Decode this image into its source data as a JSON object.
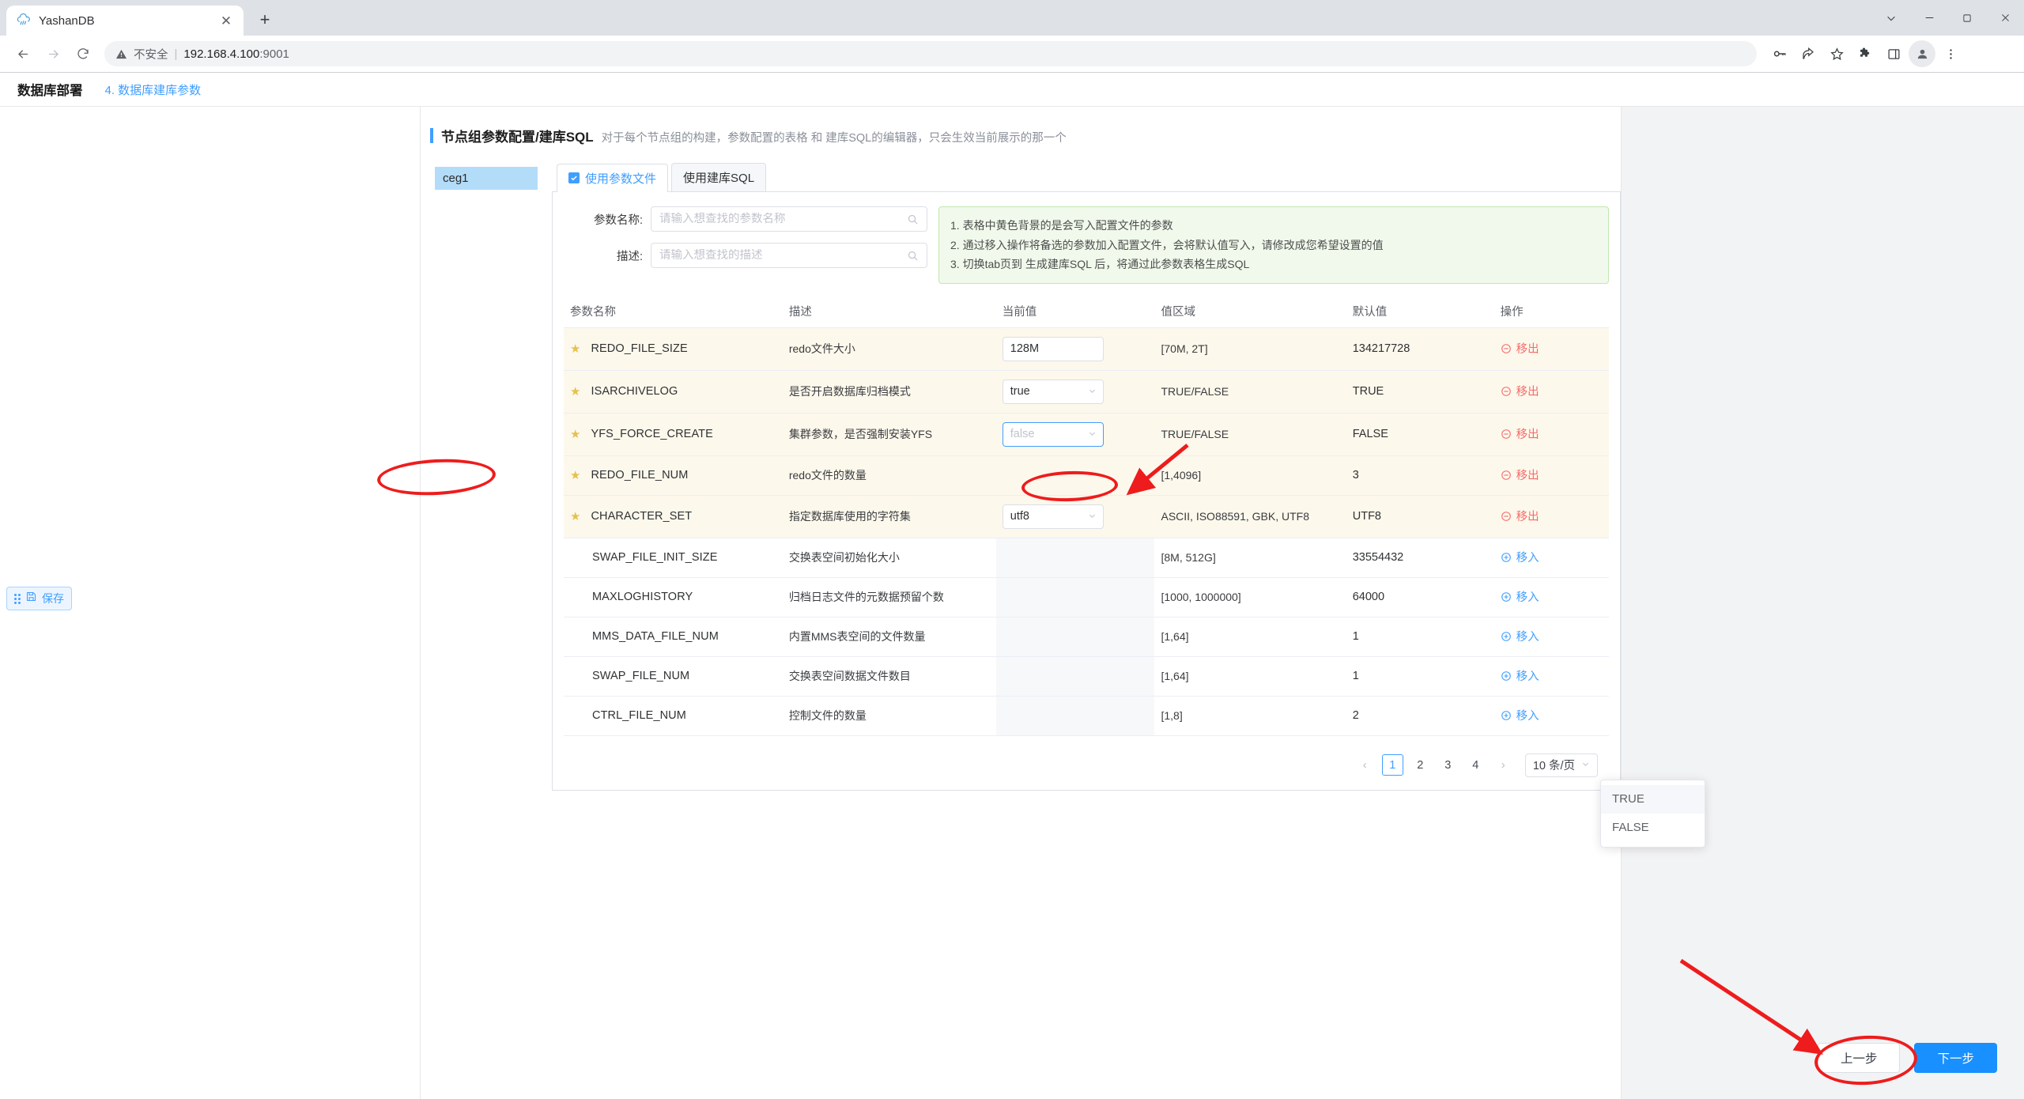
{
  "browser": {
    "tab": {
      "title": "YashanDB",
      "favicon_icon": "yashandb-logo-icon",
      "close_icon": "close-icon"
    },
    "new_tab_icon": "plus-icon",
    "window_controls": [
      {
        "name": "minimize-to-tray",
        "icon": "chevron-down-icon"
      },
      {
        "name": "minimize",
        "icon": "minimize-icon"
      },
      {
        "name": "maximize",
        "icon": "maximize-icon"
      },
      {
        "name": "close",
        "icon": "close-icon"
      }
    ],
    "nav": {
      "back_icon": "back-arrow-icon",
      "forward_icon": "forward-arrow-icon",
      "reload_icon": "reload-icon"
    },
    "omnibox": {
      "warning_icon": "warning-triangle-icon",
      "security_text": "不安全",
      "separator": "|",
      "url_host": "192.168.4.100",
      "url_port": ":9001"
    },
    "toolbar_icons": [
      {
        "name": "password-key-icon"
      },
      {
        "name": "share-icon"
      },
      {
        "name": "bookmark-star-icon"
      },
      {
        "name": "extensions-puzzle-icon"
      },
      {
        "name": "side-panel-icon"
      },
      {
        "name": "profile-avatar-icon"
      },
      {
        "name": "more-menu-icon"
      }
    ]
  },
  "app": {
    "breadcrumb": {
      "title": "数据库部署",
      "step_link": "4. 数据库建库参数"
    },
    "page": {
      "title": "节点组参数配置/建库SQL",
      "description": "对于每个节点组的构建，参数配置的表格 和 建库SQL的编辑器，只会生效当前展示的那一个"
    },
    "node_groups": [
      {
        "label": "ceg1",
        "active": true
      }
    ],
    "tabs": [
      {
        "label": "使用参数文件",
        "active": true,
        "checked": true
      },
      {
        "label": "使用建库SQL",
        "active": false,
        "checked": false
      }
    ],
    "filters": [
      {
        "label": "参数名称:",
        "value": "",
        "placeholder": "请输入想查找的参数名称",
        "icon": "search-icon"
      },
      {
        "label": "描述:",
        "value": "",
        "placeholder": "请输入想查找的描述",
        "icon": "search-icon"
      }
    ],
    "notice": [
      "1. 表格中黄色背景的是会写入配置文件的参数",
      "2. 通过移入操作将备选的参数加入配置文件，会将默认值写入，请修改成您希望设置的值",
      "3. 切换tab页到 生成建库SQL 后，将通过此参数表格生成SQL"
    ],
    "table": {
      "columns": [
        "参数名称",
        "描述",
        "当前值",
        "值区域",
        "默认值",
        "操作"
      ],
      "rows": [
        {
          "starred": true,
          "in_config": true,
          "name": "REDO_FILE_SIZE",
          "desc": "redo文件大小",
          "current": {
            "type": "input",
            "value": "128M"
          },
          "range": "[70M, 2T]",
          "default": "134217728",
          "action": {
            "label": "移出",
            "type": "remove",
            "icon": "minus-circle-icon"
          }
        },
        {
          "starred": true,
          "in_config": true,
          "name": "ISARCHIVELOG",
          "desc": "是否开启数据库归档模式",
          "current": {
            "type": "select",
            "value": "true"
          },
          "range": "TRUE/FALSE",
          "default": "TRUE",
          "action": {
            "label": "移出",
            "type": "remove",
            "icon": "minus-circle-icon"
          }
        },
        {
          "starred": true,
          "in_config": true,
          "name": "YFS_FORCE_CREATE",
          "desc": "集群参数，是否强制安装YFS",
          "current": {
            "type": "select",
            "value": "false",
            "open": true
          },
          "range": "TRUE/FALSE",
          "default": "FALSE",
          "action": {
            "label": "移出",
            "type": "remove",
            "icon": "minus-circle-icon"
          }
        },
        {
          "starred": true,
          "in_config": true,
          "name": "REDO_FILE_NUM",
          "desc": "redo文件的数量",
          "current": {
            "type": "none",
            "value": ""
          },
          "range": "[1,4096]",
          "default": "3",
          "action": {
            "label": "移出",
            "type": "remove",
            "icon": "minus-circle-icon"
          }
        },
        {
          "starred": true,
          "in_config": true,
          "name": "CHARACTER_SET",
          "desc": "指定数据库使用的字符集",
          "current": {
            "type": "select",
            "value": "utf8"
          },
          "range": "ASCII, ISO88591, GBK, UTF8",
          "default": "UTF8",
          "action": {
            "label": "移出",
            "type": "remove",
            "icon": "minus-circle-icon"
          }
        },
        {
          "starred": false,
          "in_config": false,
          "name": "SWAP_FILE_INIT_SIZE",
          "desc": "交换表空间初始化大小",
          "current": {
            "type": "none",
            "value": ""
          },
          "range": "[8M, 512G]",
          "default": "33554432",
          "action": {
            "label": "移入",
            "type": "add",
            "icon": "plus-circle-icon"
          }
        },
        {
          "starred": false,
          "in_config": false,
          "name": "MAXLOGHISTORY",
          "desc": "归档日志文件的元数据预留个数",
          "current": {
            "type": "none",
            "value": ""
          },
          "range": "[1000, 1000000]",
          "default": "64000",
          "action": {
            "label": "移入",
            "type": "add",
            "icon": "plus-circle-icon"
          }
        },
        {
          "starred": false,
          "in_config": false,
          "name": "MMS_DATA_FILE_NUM",
          "desc": "内置MMS表空间的文件数量",
          "current": {
            "type": "none",
            "value": ""
          },
          "range": "[1,64]",
          "default": "1",
          "action": {
            "label": "移入",
            "type": "add",
            "icon": "plus-circle-icon"
          }
        },
        {
          "starred": false,
          "in_config": false,
          "name": "SWAP_FILE_NUM",
          "desc": "交换表空间数据文件数目",
          "current": {
            "type": "none",
            "value": ""
          },
          "range": "[1,64]",
          "default": "1",
          "action": {
            "label": "移入",
            "type": "add",
            "icon": "plus-circle-icon"
          }
        },
        {
          "starred": false,
          "in_config": false,
          "name": "CTRL_FILE_NUM",
          "desc": "控制文件的数量",
          "current": {
            "type": "none",
            "value": ""
          },
          "range": "[1,8]",
          "default": "2",
          "action": {
            "label": "移入",
            "type": "add",
            "icon": "plus-circle-icon"
          }
        }
      ]
    },
    "dropdown": {
      "open_for": "YFS_FORCE_CREATE",
      "options": [
        {
          "label": "TRUE",
          "hovered": true
        },
        {
          "label": "FALSE",
          "hovered": false
        }
      ]
    },
    "pagination": {
      "prev_icon": "chevron-left-icon",
      "next_icon": "chevron-right-icon",
      "pages": [
        "1",
        "2",
        "3",
        "4"
      ],
      "current_page": "1",
      "page_size_label": "10 条/页",
      "page_size_caret": "chevron-down-icon"
    },
    "save_button": {
      "label": "保存",
      "icon": "floppy-disk-icon",
      "drag_handle": "drag-dots-icon"
    },
    "footer": {
      "prev_label": "上一步",
      "next_label": "下一步",
      "next_color": "#1890ff"
    }
  },
  "annotations": {
    "circle_param_name": "YFS_FORCE_CREATE",
    "circle_dropdown_option": "TRUE",
    "circle_next_button": "下一步",
    "arrow_color": "#ee1c1c"
  }
}
